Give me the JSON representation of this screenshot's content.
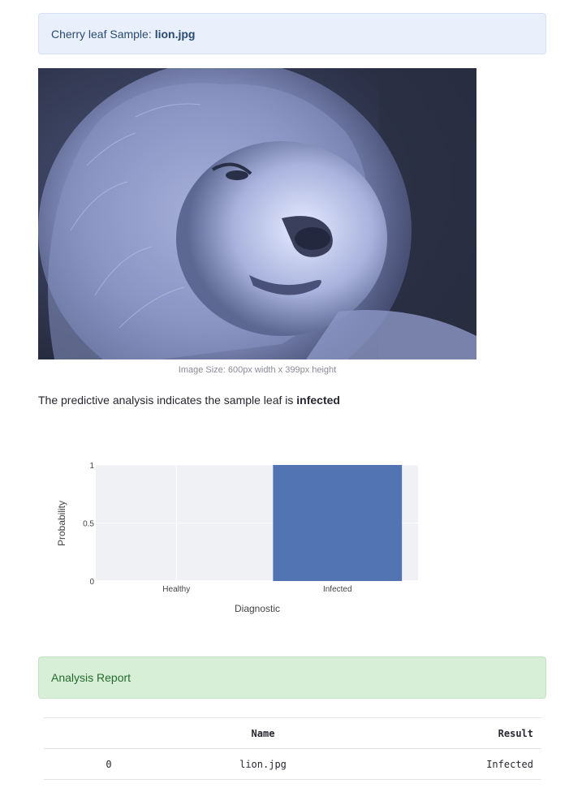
{
  "sample_header": {
    "label": "Cherry leaf Sample:",
    "filename": "lion.jpg"
  },
  "image": {
    "subject": "lion portrait (blue-tinted photo)",
    "caption": "Image Size: 600px width x 399px height"
  },
  "analysis": {
    "text": "The predictive analysis indicates the sample leaf is",
    "result": "infected"
  },
  "chart_data": {
    "type": "bar",
    "categories": [
      "Healthy",
      "Infected"
    ],
    "values": [
      0,
      1
    ],
    "title": "",
    "xlabel": "Diagnostic",
    "ylabel": "Probability",
    "ylim": [
      0,
      1
    ],
    "yticks": [
      "0",
      "0.5",
      "1"
    ],
    "grid": true,
    "bar_color": "#5274b3",
    "plot_bg": "#f0f1f5"
  },
  "report": {
    "title": "Analysis Report",
    "columns": [
      "",
      "Name",
      "Result"
    ],
    "rows": [
      [
        "0",
        "lion.jpg",
        "Infected"
      ]
    ]
  },
  "colors": {
    "info_bg": "#e9f0fb",
    "success_bg": "#d6efd6"
  }
}
